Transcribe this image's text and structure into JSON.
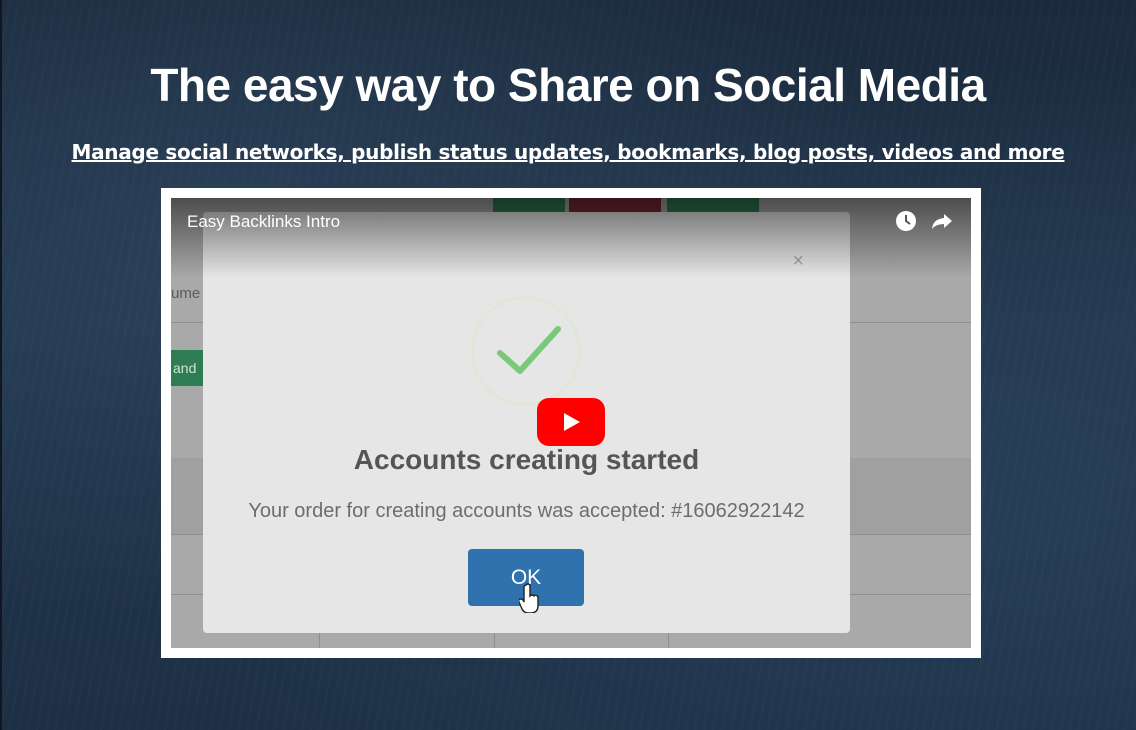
{
  "hero": {
    "headline": "The easy way to Share on Social Media",
    "subline": "Manage social networks, publish status updates, bookmarks, blog posts, videos and more"
  },
  "video": {
    "title": "Easy Backlinks Intro",
    "icons": [
      "watch-later-icon",
      "share-icon",
      "youtube-play-icon"
    ],
    "app_behind": {
      "side_text": "ume",
      "side_button": "and",
      "top_button_colors": [
        "#2f7d52",
        "#7a2a34",
        "#2f7d52"
      ]
    },
    "modal": {
      "close": "×",
      "title": "Accounts creating started",
      "text": "Your order for creating accounts was accepted: #16062922142",
      "ok_label": "OK"
    }
  },
  "colors": {
    "background": "#1c2d40",
    "ok_button": "#2f72ad",
    "play_button": "#ff0000",
    "checkmark": "#7ac97a"
  }
}
